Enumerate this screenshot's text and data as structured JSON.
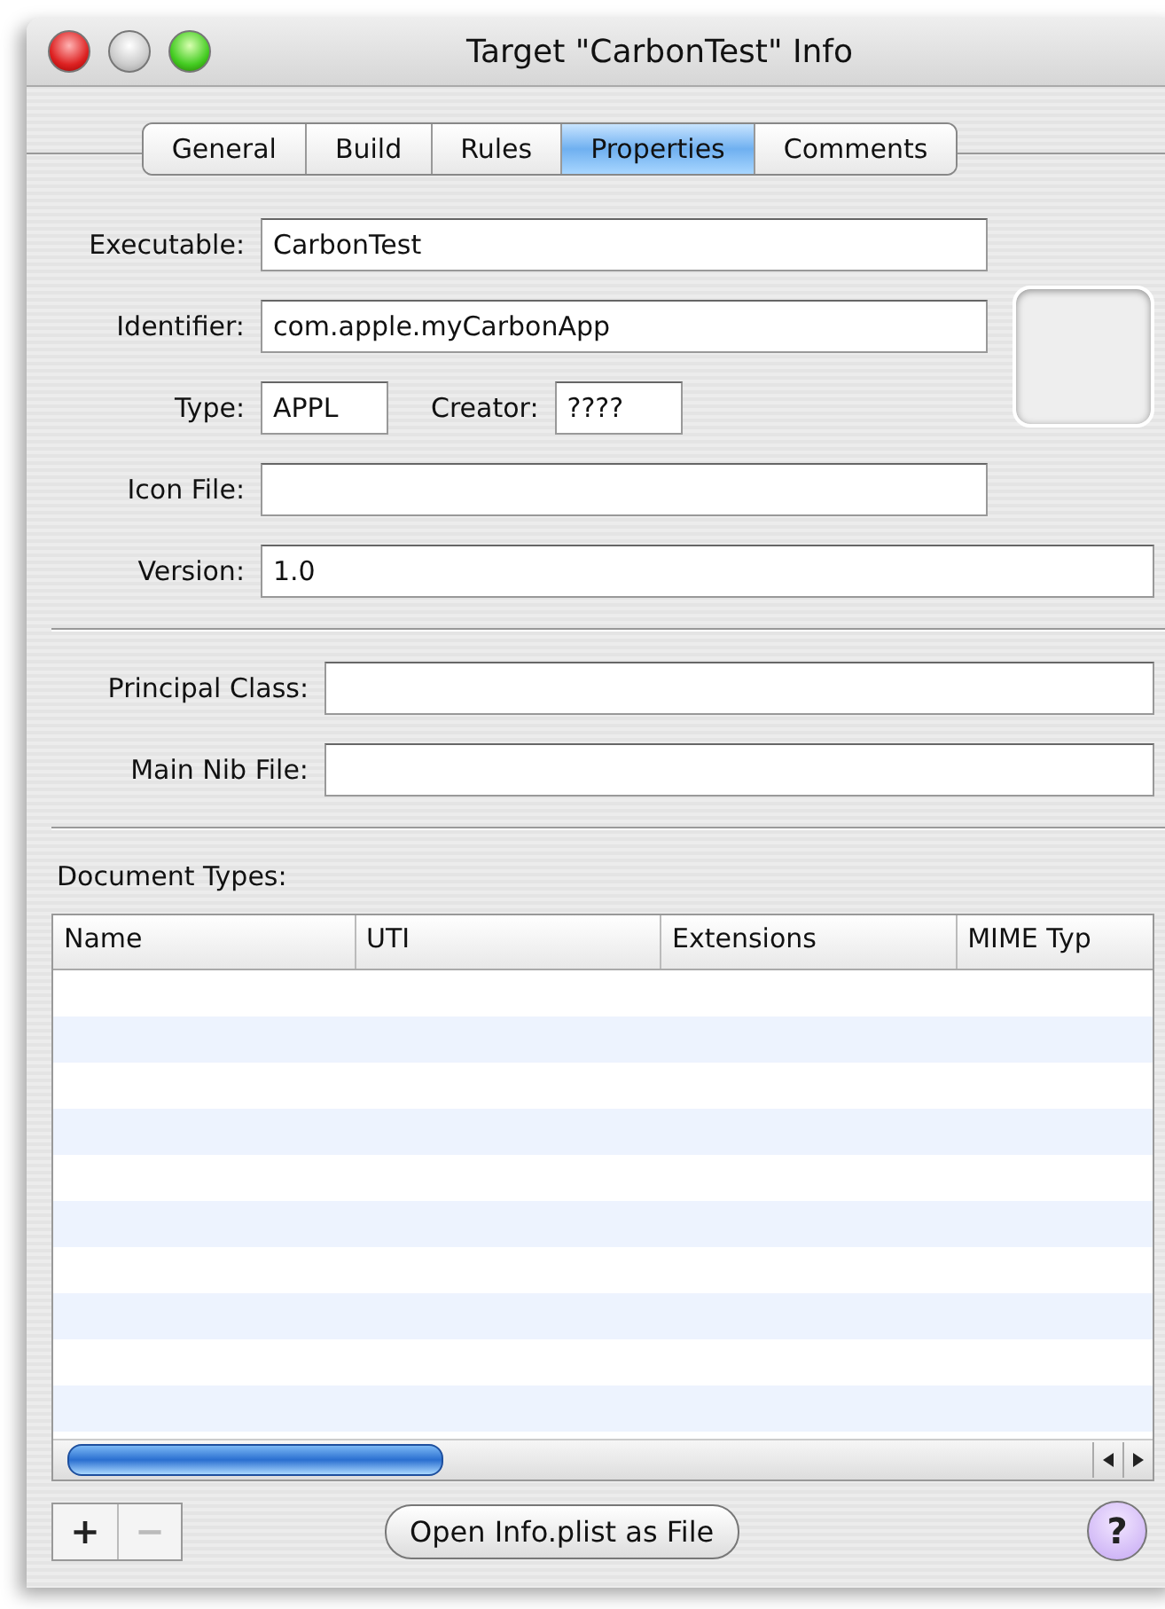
{
  "window": {
    "title": "Target \"CarbonTest\" Info"
  },
  "tabs": [
    {
      "label": "General",
      "selected": false
    },
    {
      "label": "Build",
      "selected": false
    },
    {
      "label": "Rules",
      "selected": false
    },
    {
      "label": "Properties",
      "selected": true
    },
    {
      "label": "Comments",
      "selected": false
    }
  ],
  "executable": {
    "label": "Executable:",
    "value": "CarbonTest"
  },
  "identifier": {
    "label": "Identifier:",
    "value": "com.apple.myCarbonApp"
  },
  "type": {
    "label": "Type:",
    "value": "APPL"
  },
  "creator": {
    "label": "Creator:",
    "value": "????"
  },
  "icon_file": {
    "label": "Icon File:"
  },
  "version": {
    "label": "Version:",
    "value": "1.0"
  },
  "principal_class": {
    "label": "Principal Class:"
  },
  "main_nib_file": {
    "label": "Main Nib File:"
  },
  "document_types": {
    "label": "Document Types:",
    "columns": [
      "Name",
      "UTI",
      "Extensions",
      "MIME Typ"
    ]
  },
  "add_button": {
    "label": "+",
    "disabled": false
  },
  "remove_button": {
    "label": "−",
    "disabled": true
  },
  "open_button": {
    "label": "Open Info.plist as File"
  },
  "help_button": {
    "label": "?"
  }
}
